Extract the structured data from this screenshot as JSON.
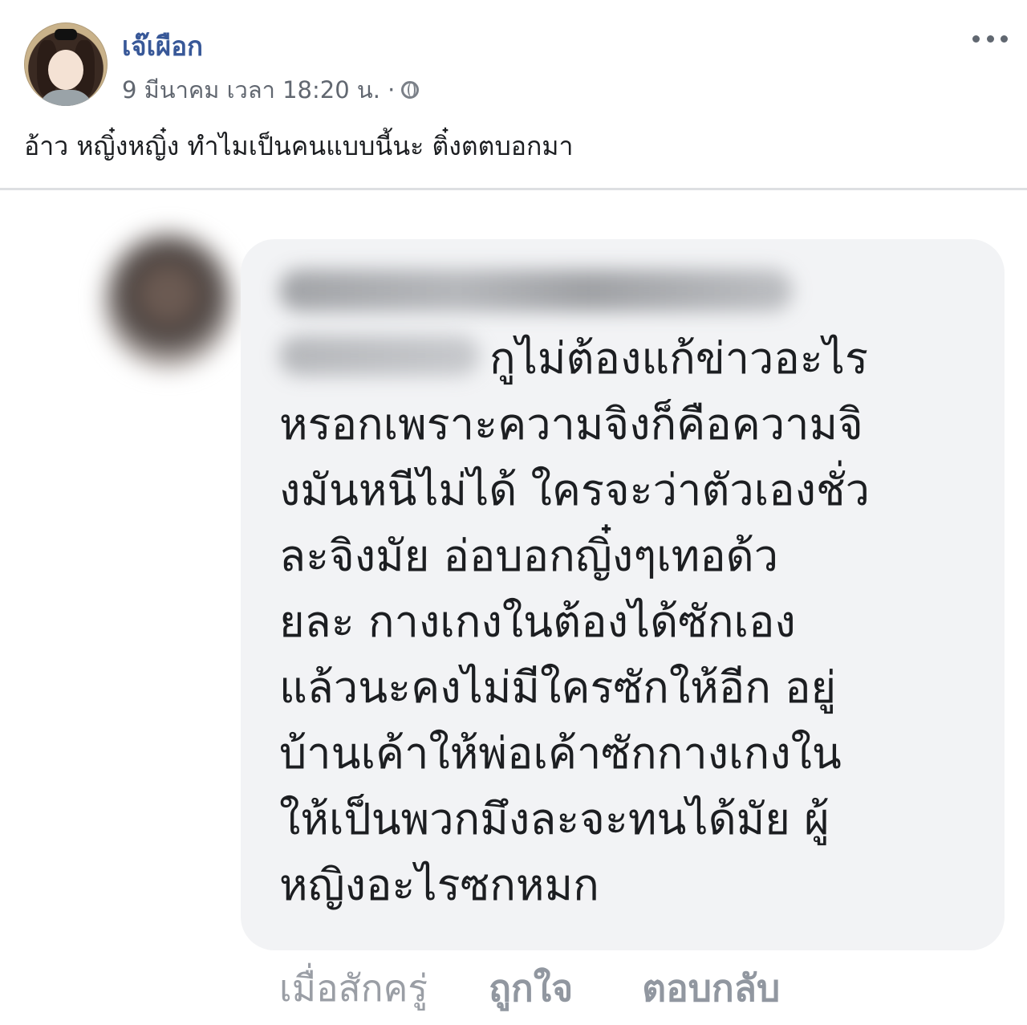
{
  "post": {
    "author": "เจ๊เผือก",
    "timestamp": "9 มีนาคม เวลา 18:20 น. ·",
    "text": "อ้าว หญิ๋งหญิ๋ง ทำไมเป็นคนแบบนี้นะ ติ๋งตตบอกมา",
    "more_icon": "more-options-icon",
    "audience_icon": "globe-icon"
  },
  "comment": {
    "lines": [
      "กูไม่ต้องแก้ข่าวอะไร",
      "หรอกเพราะความจิงก็คือความจิ",
      "งมันหนีไม่ได้ ใครจะว่าตัวเองชั่ว",
      "ละจิงมัย อ่อบอกญิ๋งๆเทอด้ว",
      "ยละ กางเกงในต้องได้ซักเอง",
      "แล้วนะคงไม่มีใครซักให้อีก อยู่",
      "บ้านเค้าให้พ่อเค้าซักกางเกงใน",
      "ให้เป็นพวกมึงละจะทนได้มัย ผู้",
      "หญิงอะไรซกหมก"
    ],
    "time": "เมื่อสักครู่",
    "like_label": "ถูกใจ",
    "reply_label": "ตอบกลับ"
  },
  "colors": {
    "author_name": "#385898",
    "meta": "#616770",
    "bubble_bg": "#f2f3f5",
    "action_text": "#9197a0"
  }
}
